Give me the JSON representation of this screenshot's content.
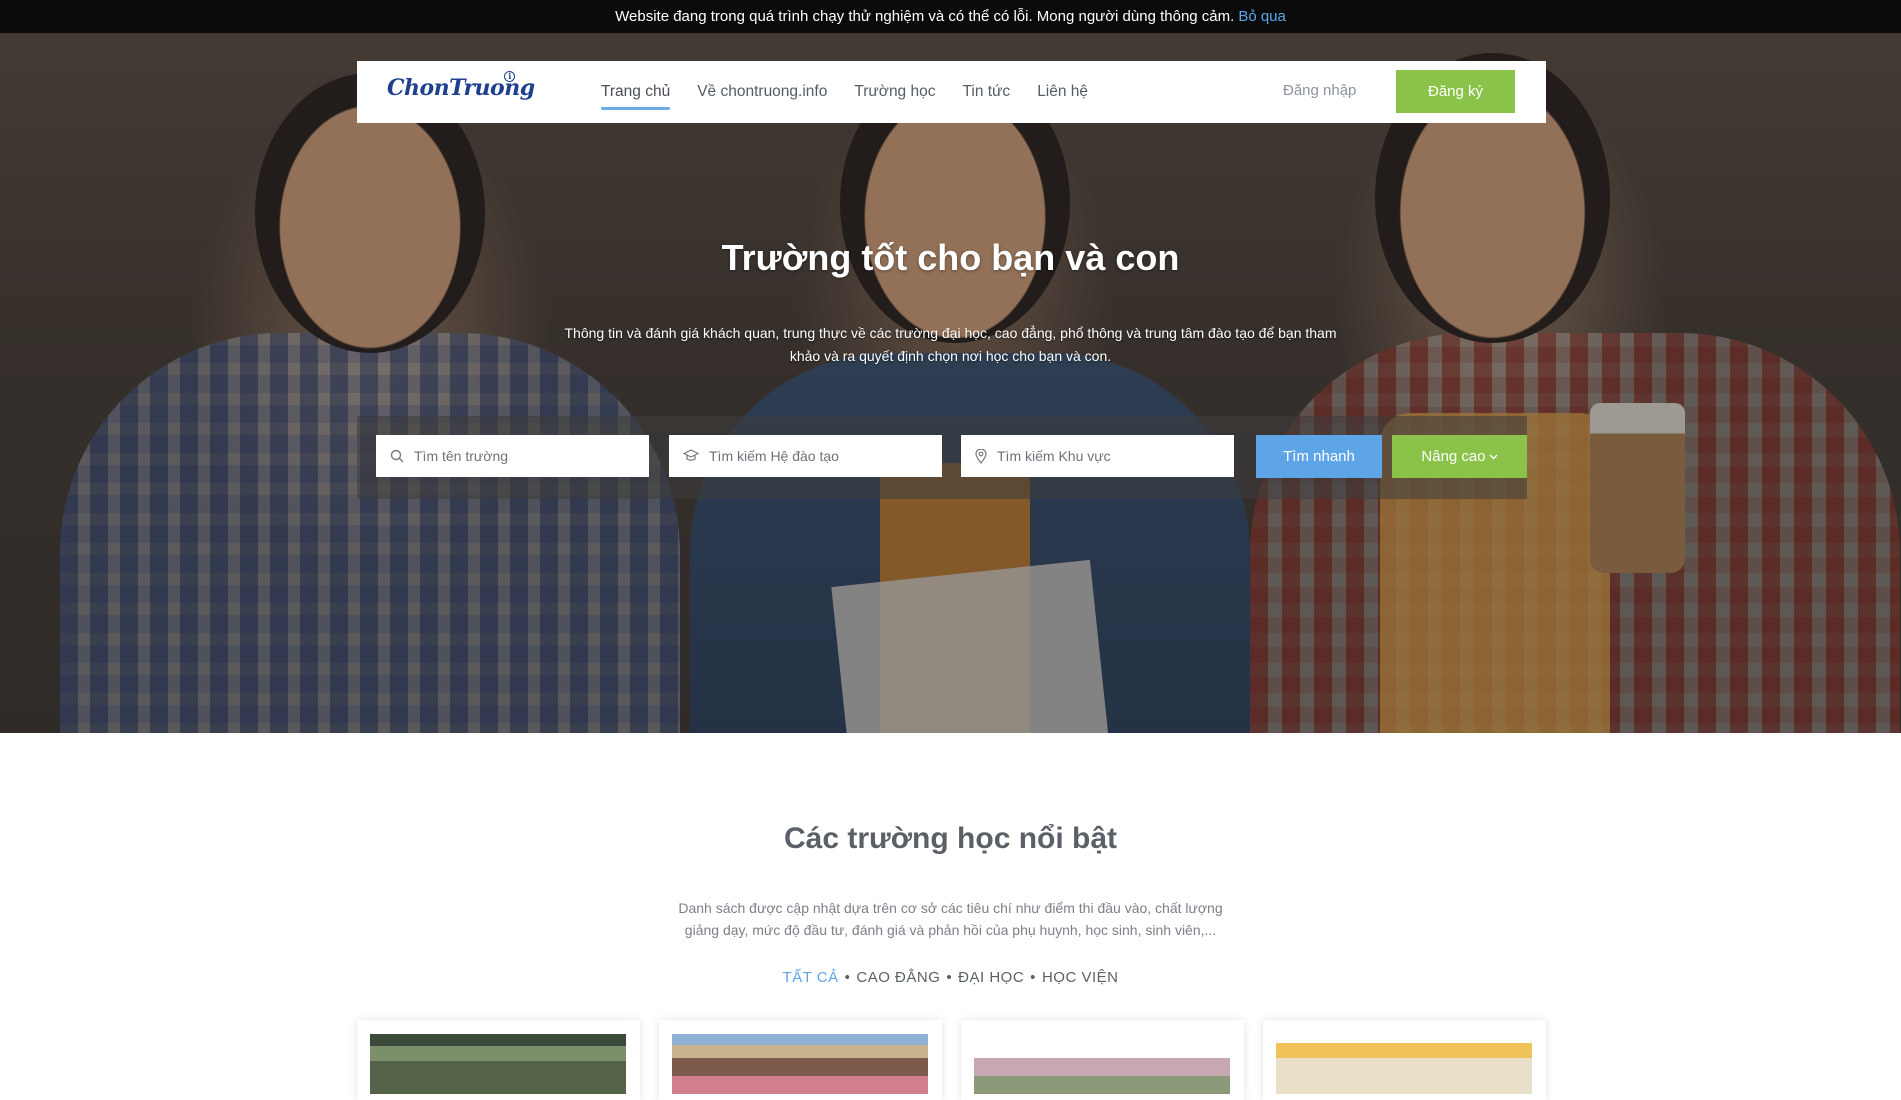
{
  "notice": {
    "text": "Website đang trong quá trình chạy thử nghiệm và có thể có lỗi. Mong người dùng thông cảm.",
    "skip_label": "Bỏ qua"
  },
  "logo": {
    "text": "ChonTruong",
    "badge": "i"
  },
  "nav": {
    "items": [
      {
        "label": "Trang chủ",
        "active": true
      },
      {
        "label": "Về chontruong.info"
      },
      {
        "label": "Trường học"
      },
      {
        "label": "Tin tức"
      },
      {
        "label": "Liên hệ"
      }
    ],
    "login_label": "Đăng nhập",
    "register_label": "Đăng ký"
  },
  "hero": {
    "title": "Trường tốt cho bạn và con",
    "subtitle": "Thông tin và đánh giá khách quan, trung thực về các trường đại học, cao đẳng, phổ thông và trung tâm đào tạo để bạn tham khảo và ra quyết định chọn nơi học cho bạn và con."
  },
  "search": {
    "school_placeholder": "Tìm tên trường",
    "program_placeholder": "Tìm kiếm Hệ đào tạo",
    "region_placeholder": "Tìm kiếm Khu vực",
    "quick_label": "Tìm nhanh",
    "advanced_label": "Nâng cao"
  },
  "featured": {
    "title": "Các trường học nổi bật",
    "description": "Danh sách được cập nhật dựa trên cơ sở các tiêu chí như điểm thi đầu vào, chất lượng giảng dạy, mức độ đầu tư, đánh giá và phản hồi của phụ huynh, học sinh, sinh viên,...",
    "filters": [
      {
        "label": "TẤT CẢ",
        "active": true
      },
      {
        "label": "CAO ĐẲNG"
      },
      {
        "label": "ĐẠI HỌC"
      },
      {
        "label": "HỌC VIỆN"
      }
    ],
    "filter_separator": "•"
  },
  "colors": {
    "accent_blue": "#5ea5e8",
    "accent_green": "#8bc34a",
    "logo_blue": "#1f3f8f",
    "notice_bg": "#0b0b0b"
  }
}
